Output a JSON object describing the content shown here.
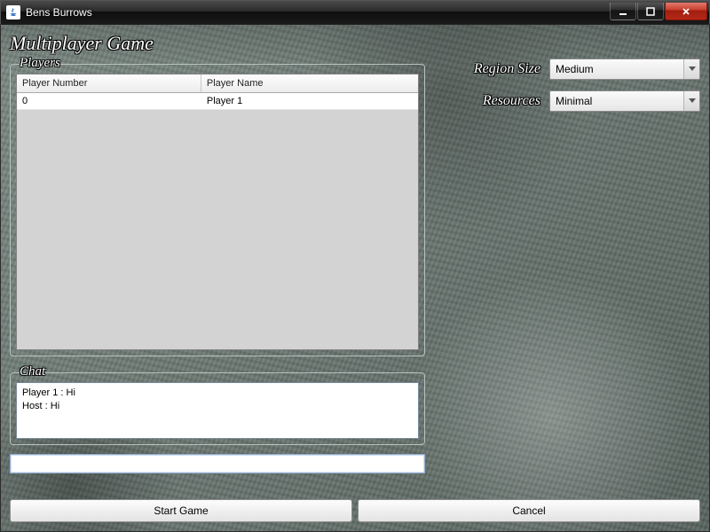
{
  "window": {
    "title": "Bens Burrows"
  },
  "page_title": "Multiplayer Game",
  "players_group_label": "Players",
  "table": {
    "columns": [
      "Player Number",
      "Player Name"
    ],
    "rows": [
      {
        "number": "0",
        "name": "Player 1"
      }
    ]
  },
  "chat_group_label": "Chat",
  "chat": {
    "messages": [
      "Player 1 : Hi",
      "Host : Hi"
    ],
    "input_value": ""
  },
  "settings": {
    "region_size": {
      "label": "Region Size",
      "value": "Medium"
    },
    "resources": {
      "label": "Resources",
      "value": "Minimal"
    }
  },
  "buttons": {
    "start": "Start Game",
    "cancel": "Cancel"
  }
}
